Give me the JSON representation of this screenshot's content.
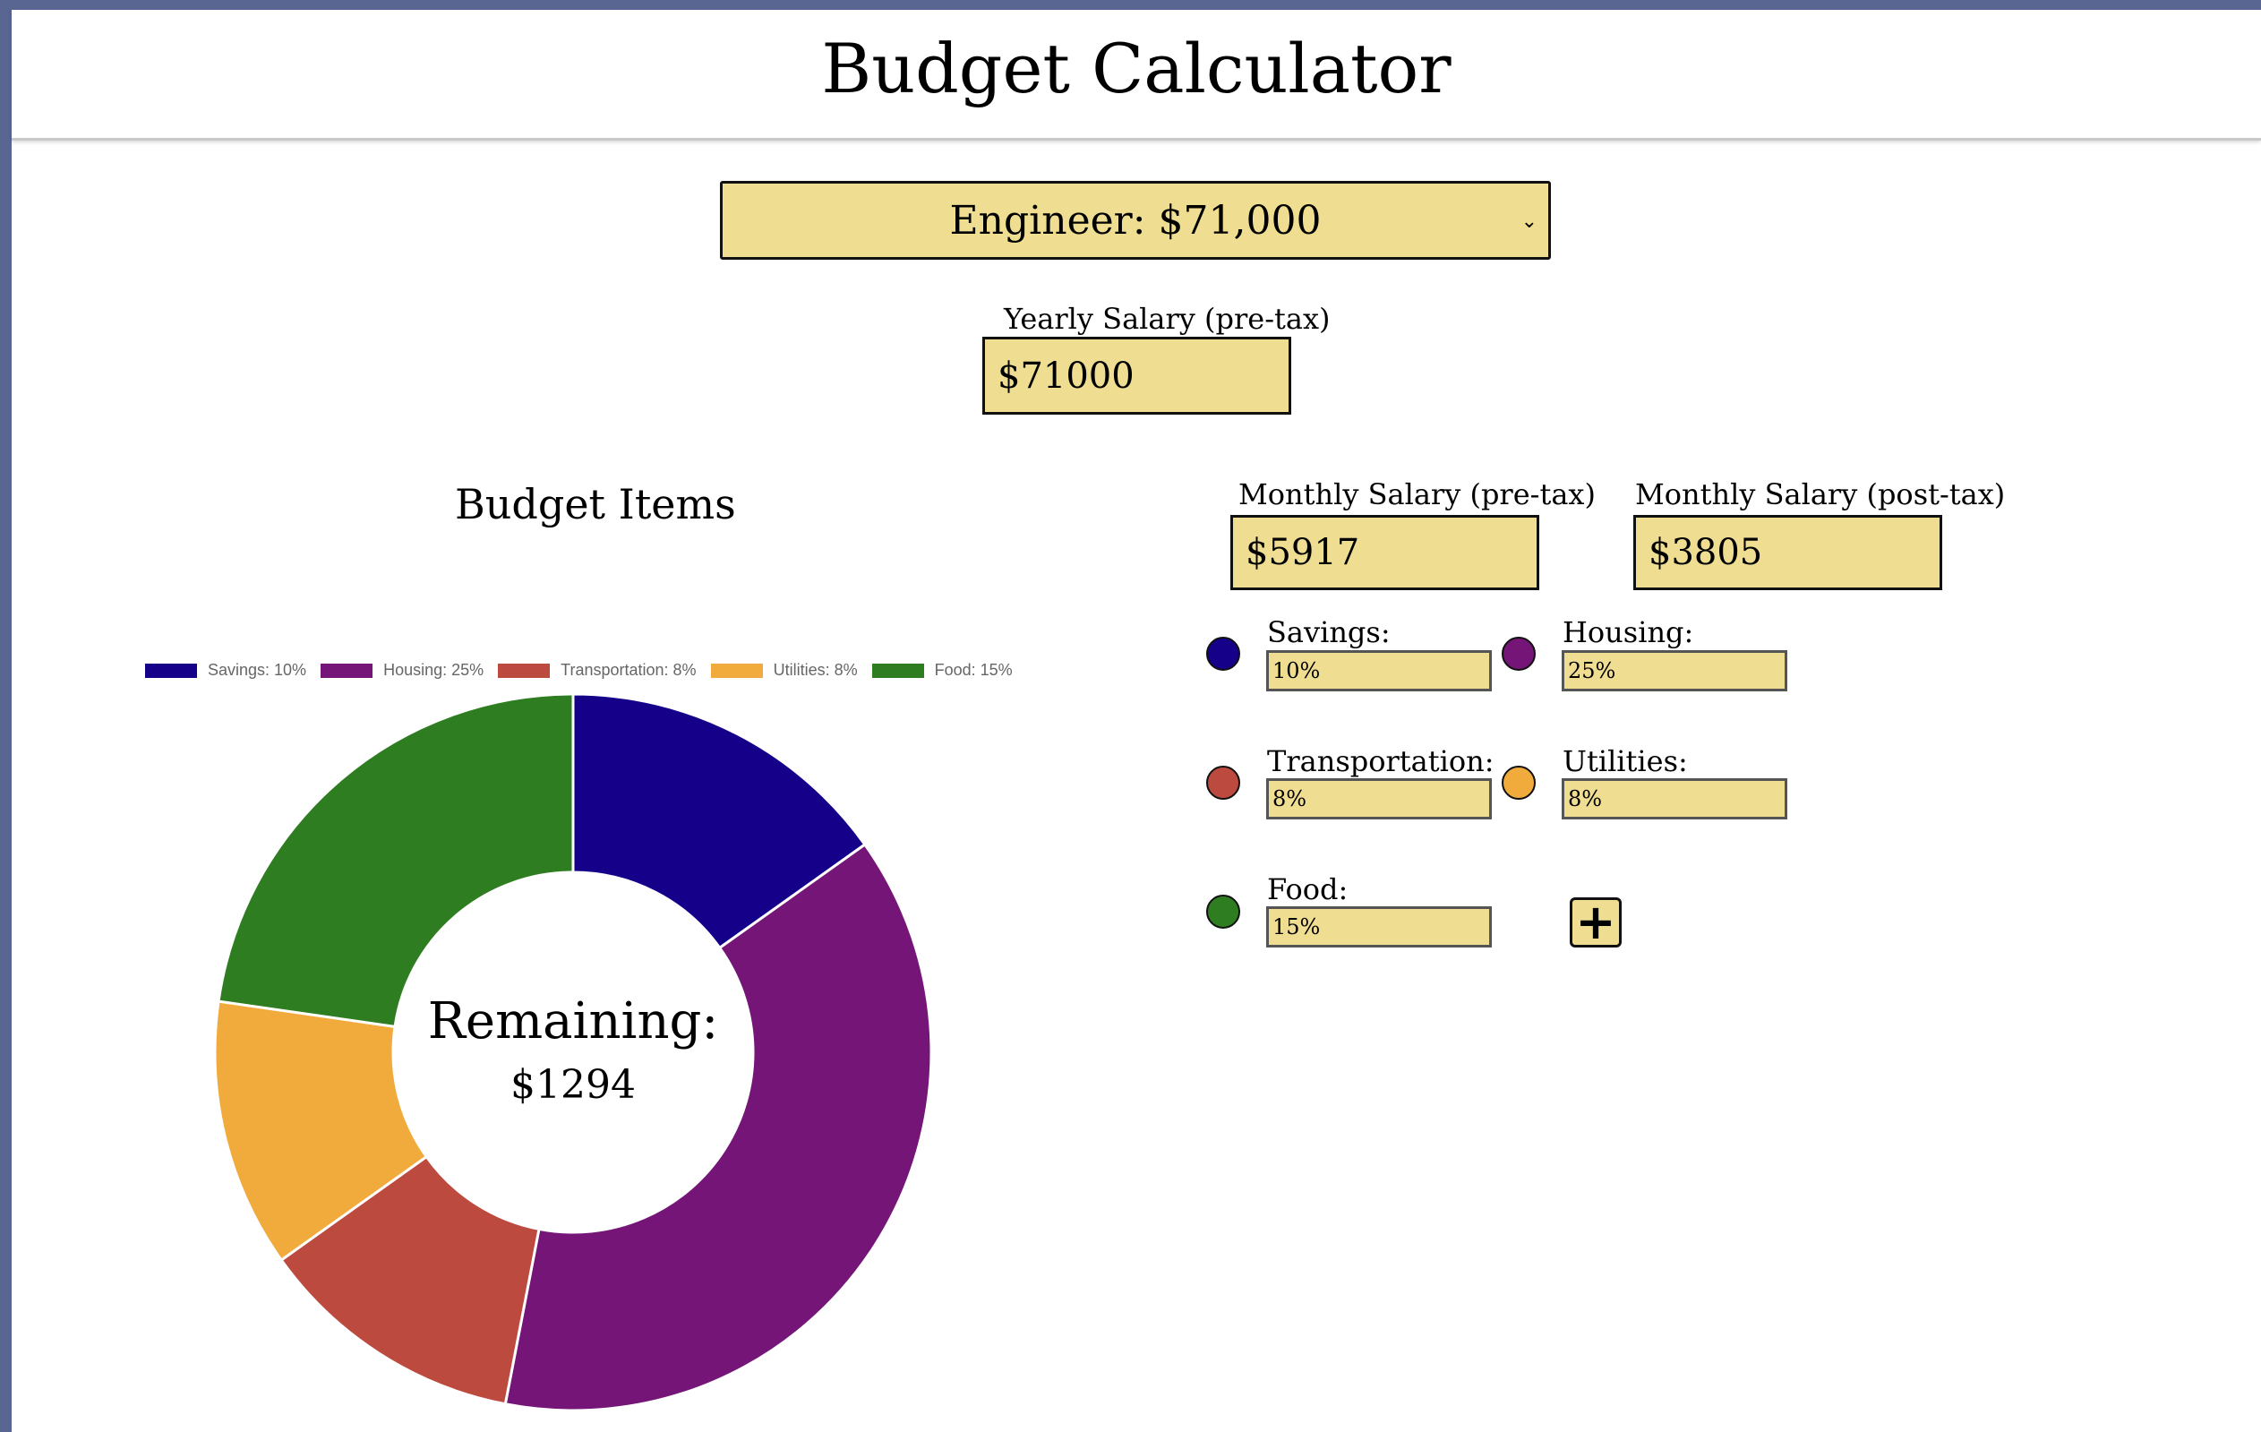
{
  "page": {
    "title": "Budget Calculator"
  },
  "job_select": {
    "value": "Engineer: $71,000"
  },
  "yearly": {
    "label": "Yearly Salary (pre-tax)",
    "value": "$71000"
  },
  "monthly_pre": {
    "label": "Monthly Salary (pre-tax)",
    "value": "$5917"
  },
  "monthly_post": {
    "label": "Monthly Salary (post-tax)",
    "value": "$3805"
  },
  "budget_items_title": "Budget Items",
  "items": [
    {
      "label": "Savings:",
      "value": "10%",
      "color": "#15008a"
    },
    {
      "label": "Housing:",
      "value": "25%",
      "color": "#741577"
    },
    {
      "label": "Transportation:",
      "value": "8%",
      "color": "#bd4a3e"
    },
    {
      "label": "Utilities:",
      "value": "8%",
      "color": "#f1aa3c"
    },
    {
      "label": "Food:",
      "value": "15%",
      "color": "#2f7d21"
    }
  ],
  "add_button": "+",
  "remaining": {
    "label": "Remaining:",
    "value": "$1294"
  },
  "chart_data": {
    "type": "pie",
    "variant": "doughnut",
    "legend_position": "top",
    "legend": [
      "Savings: 10%",
      "Housing: 25%",
      "Transportation: 8%",
      "Utilities: 8%",
      "Food: 15%"
    ],
    "series": [
      {
        "name": "Savings: 10%",
        "value": 10,
        "color": "#15008a"
      },
      {
        "name": "Housing: 25%",
        "value": 25,
        "color": "#741577"
      },
      {
        "name": "Transportation: 8%",
        "value": 8,
        "color": "#bd4a3e"
      },
      {
        "name": "Utilities: 8%",
        "value": 8,
        "color": "#f1aa3c"
      },
      {
        "name": "Food: 15%",
        "value": 15,
        "color": "#2f7d21"
      }
    ]
  }
}
